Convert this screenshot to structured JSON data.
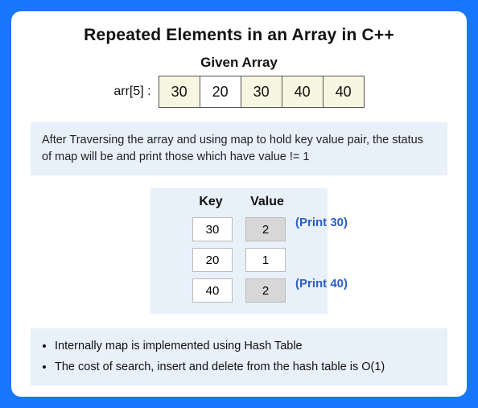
{
  "title": "Repeated Elements in an Array in C++",
  "array_section": {
    "subtitle": "Given Array",
    "label": "arr[5] :",
    "cells": [
      "30",
      "20",
      "30",
      "40",
      "40"
    ],
    "highlight": [
      true,
      false,
      true,
      true,
      true
    ]
  },
  "explanation": "After Traversing the array and using map to hold key value pair, the status of map will be and print those which have value != 1",
  "kv_table": {
    "headers": [
      "Key",
      "Value"
    ],
    "rows": [
      {
        "key": "30",
        "value": "2",
        "grey": true,
        "print": "(Print 30)"
      },
      {
        "key": "20",
        "value": "1",
        "grey": false,
        "print": ""
      },
      {
        "key": "40",
        "value": "2",
        "grey": true,
        "print": "(Print 40)"
      }
    ]
  },
  "bullets": [
    "Internally map is implemented using Hash Table",
    "The cost of search, insert and delete from the hash table is O(1)"
  ],
  "chart_data": {
    "type": "table",
    "title": "Map key-value after traversal",
    "columns": [
      "Key",
      "Value"
    ],
    "rows": [
      [
        30,
        2
      ],
      [
        20,
        1
      ],
      [
        40,
        2
      ]
    ],
    "input_array": [
      30,
      20,
      30,
      40,
      40
    ],
    "repeated_output": [
      30,
      40
    ]
  }
}
